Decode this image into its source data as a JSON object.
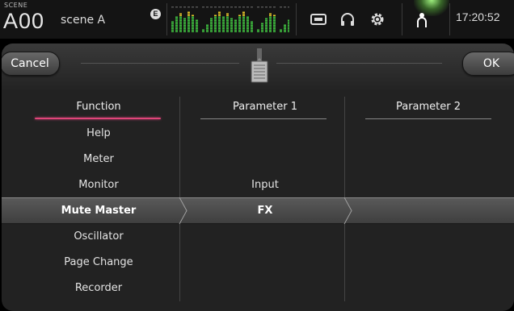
{
  "header": {
    "scene_label": "SCENE",
    "scene_number": "A00",
    "scene_name": "scene A",
    "edit_badge": "E",
    "clock": "17:20:52",
    "icons": [
      "edit-indicator-icon",
      "level-meter-icon",
      "recorder-icon",
      "headphones-icon",
      "setup-gear-icon",
      "user-icon"
    ]
  },
  "dialog": {
    "cancel_label": "Cancel",
    "ok_label": "OK",
    "icon": "fader-icon"
  },
  "columns": {
    "function_header": "Function",
    "param1_header": "Parameter 1",
    "param2_header": "Parameter 2"
  },
  "function_items": [
    {
      "label": "Help"
    },
    {
      "label": "Meter"
    },
    {
      "label": "Monitor"
    },
    {
      "label": "Mute Master"
    },
    {
      "label": "Oscillator"
    },
    {
      "label": "Page Change"
    },
    {
      "label": "Recorder"
    }
  ],
  "parameter1_items": [
    {
      "label": "Input"
    },
    {
      "label": "FX"
    }
  ],
  "selection": {
    "function": "Mute Master",
    "parameter1": "FX",
    "parameter2": ""
  },
  "colors": {
    "accent_underline": "#e0457a",
    "status_glow": "#9ef07e",
    "meter_green": "#3fbf3f",
    "meter_yellow": "#e6c32a",
    "meter_red": "#e04040"
  }
}
